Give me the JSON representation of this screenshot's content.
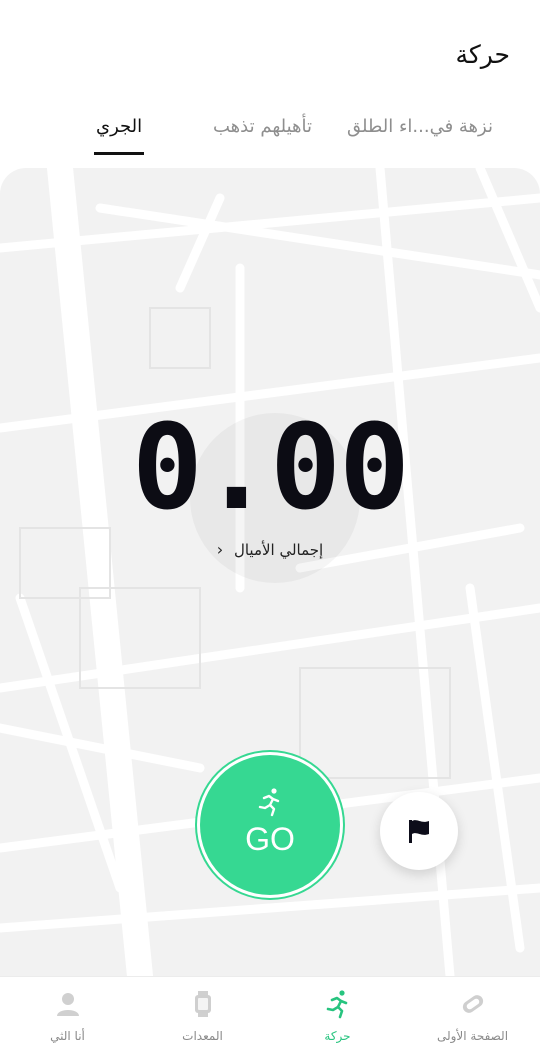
{
  "header": {
    "title": "حركة"
  },
  "tabs": [
    {
      "label": "الجري",
      "active": true
    },
    {
      "label": "تأهيلهم تذهب",
      "active": false
    },
    {
      "label": "نزهة في...اء الطلق",
      "active": false
    }
  ],
  "stats": {
    "distance": "0.00",
    "total_label": "إجمالي الأميال"
  },
  "actions": {
    "go_label": "GO",
    "go_icon": "running-person-icon",
    "flag_icon": "flag-icon"
  },
  "bottom_nav": [
    {
      "label": "الصفحة الأولى",
      "icon": "home-icon",
      "active": false
    },
    {
      "label": "حركة",
      "icon": "running-icon",
      "active": true
    },
    {
      "label": "المعدات",
      "icon": "watch-icon",
      "active": false
    },
    {
      "label": "أنا الثي",
      "icon": "profile-icon",
      "active": false
    }
  ],
  "colors": {
    "accent": "#36d892",
    "map_bg": "#f2f2f2",
    "text": "#111111"
  }
}
